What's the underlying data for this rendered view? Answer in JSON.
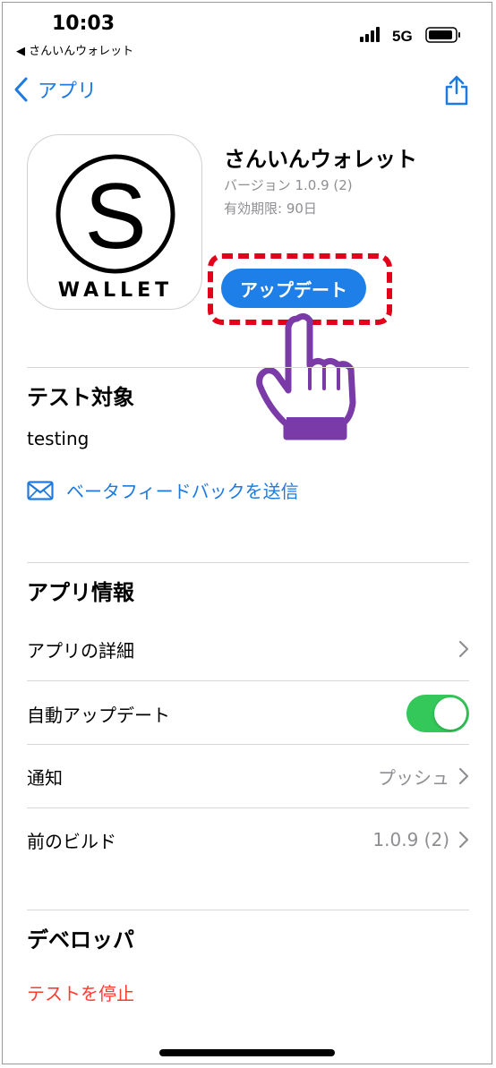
{
  "status_bar": {
    "time": "10:03",
    "back_app": "◀ さんいんウォレット",
    "network": "5G"
  },
  "nav": {
    "back_label": "アプリ",
    "share_icon": "share-icon"
  },
  "app": {
    "name": "さんいんウォレット",
    "version": "バージョン 1.0.9 (2)",
    "expiry": "有効期限: 90日",
    "icon_letter": "S",
    "icon_wordmark": "WALLET",
    "update_label": "アップデート"
  },
  "test_section": {
    "title": "テスト対象",
    "value": "testing",
    "feedback_label": "ベータフィードバックを送信"
  },
  "info_section": {
    "title": "アプリ情報",
    "rows": [
      {
        "label": "アプリの詳細",
        "value": ""
      },
      {
        "label": "自動アップデート",
        "value": ""
      },
      {
        "label": "通知",
        "value": "プッシュ"
      },
      {
        "label": "前のビルド",
        "value": "1.0.9 (2)"
      }
    ],
    "auto_update_on": true
  },
  "developer_section": {
    "title": "デベロッパ",
    "stop_label": "テストを停止"
  },
  "colors": {
    "accent": "#1e7ae0",
    "button": "#1f7fe8",
    "toggle_on": "#34c759",
    "destructive": "#ff3b30",
    "highlight": "#e3001b",
    "hand": "#7a3aa8"
  }
}
